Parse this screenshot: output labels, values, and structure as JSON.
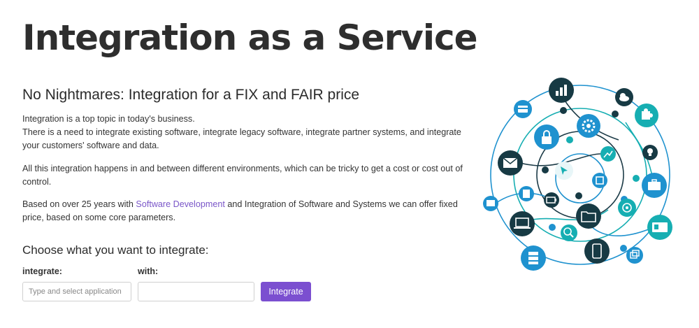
{
  "header": {
    "title": "Integration as a Service"
  },
  "intro": {
    "subtitle": "No Nightmares: Integration for a FIX and FAIR price",
    "p1_line1": "Integration is a top topic in today's business.",
    "p1_line2": "There is a need to integrate existing software, integrate legacy software, integrate partner systems, and integrate your customers' software and data.",
    "p2": "All this integration happens in and between different environments, which can be tricky to get a cost or cost out of control.",
    "p3_before": "Based on over 25 years with ",
    "p3_link": "Software Development",
    "p3_after": " and Integration of Software and Systems we can offer fixed price, based on some core parameters."
  },
  "form": {
    "heading": "Choose what you want to integrate:",
    "integrate_label": "integrate:",
    "integrate_placeholder": "Type and select application",
    "integrate_value": "",
    "with_label": "with:",
    "with_placeholder": "",
    "with_value": "",
    "button_label": "Integrate"
  },
  "illustration": {
    "colors": {
      "dark": "#1c3b47",
      "blue": "#1f92cf",
      "teal": "#16aeb2",
      "node_dark": "#173a44"
    },
    "icons": [
      "chart-icon",
      "cloud-icon",
      "puzzle-icon",
      "card-icon",
      "lock-icon",
      "gear-icon",
      "envelope-icon",
      "cursor-icon",
      "growth-icon",
      "lightbulb-icon",
      "chip-icon",
      "briefcase-icon",
      "document-icon",
      "mobile-icon",
      "battery-icon",
      "folder-icon",
      "target-icon",
      "id-card-icon",
      "laptop-icon",
      "search-icon",
      "smartphone-icon",
      "server-icon",
      "windows-icon",
      "message-icon"
    ]
  },
  "accent": "#7b4fd0",
  "link_color": "#7a56c8"
}
